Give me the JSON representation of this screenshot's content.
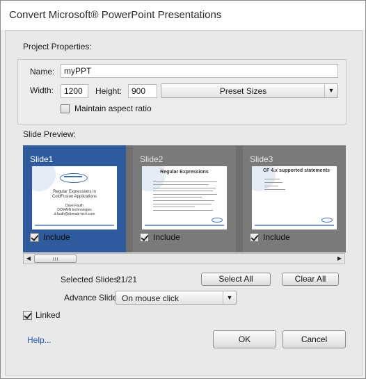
{
  "window": {
    "title": "Convert Microsoft® PowerPoint Presentations"
  },
  "project": {
    "heading": "Project Properties:",
    "name_label": "Name:",
    "name_value": "myPPT",
    "width_label": "Width:",
    "width_value": "1200",
    "height_label": "Height:",
    "height_value": "900",
    "preset_label": "Preset Sizes",
    "aspect_label": "Maintain aspect ratio"
  },
  "preview": {
    "heading": "Slide Preview:",
    "include_label": "Include",
    "slides": [
      {
        "name": "Slide1",
        "title_lines": [
          "Regular Expressions in",
          "ColdFusion Applications"
        ],
        "body_lines": [
          "Dave Fauth",
          "DOMAIN technologies",
          "d.fauth@domain-tech.com"
        ]
      },
      {
        "name": "Slide2",
        "title_lines": [
          "Regular Expressions"
        ]
      },
      {
        "name": "Slide3",
        "title_lines": [
          "CF 4.x supported statements"
        ]
      }
    ]
  },
  "selection": {
    "selected_label": "Selected Slides:",
    "selected_value": "21/21",
    "select_all": "Select All",
    "clear_all": "Clear All",
    "advance_label": "Advance Slide:",
    "advance_value": "On mouse click"
  },
  "linked_label": "Linked",
  "footer": {
    "help": "Help...",
    "ok": "OK",
    "cancel": "Cancel"
  },
  "colors": {
    "selected_slide_bg": "#2f5a9e",
    "unselected_slide_bg": "#7a7a7a",
    "link": "#1f5fb5"
  }
}
